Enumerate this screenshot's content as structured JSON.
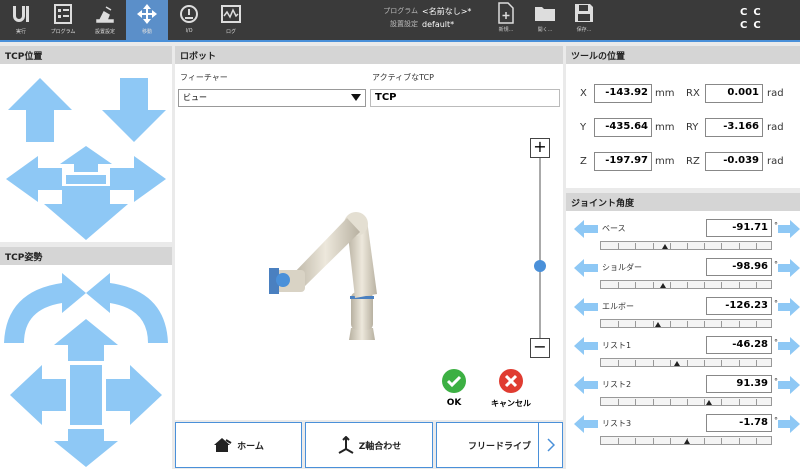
{
  "topbar": {
    "nav": [
      {
        "label": "実行",
        "icon": "ur-logo-icon"
      },
      {
        "label": "プログラム",
        "icon": "program-icon"
      },
      {
        "label": "設置設定",
        "icon": "installation-icon"
      },
      {
        "label": "移動",
        "icon": "move-icon"
      },
      {
        "label": "I/O",
        "icon": "io-icon"
      },
      {
        "label": "ログ",
        "icon": "log-icon"
      }
    ],
    "program_label": "プログラム",
    "program_value": "<名前なし>*",
    "install_label": "設置設定",
    "install_value": "default*",
    "new_label": "新規...",
    "open_label": "開く...",
    "save_label": "保存...",
    "cc_text": "CC CC"
  },
  "tcp_position": {
    "title": "TCP位置"
  },
  "tcp_orientation": {
    "title": "TCP姿勢"
  },
  "robot": {
    "title": "ロボット",
    "feature_label": "フィーチャー",
    "feature_value": "ビュー",
    "active_tcp_label": "アクティブなTCP",
    "active_tcp_value": "TCP",
    "zoom_in": "+",
    "zoom_out": "−",
    "zoom_level": 0.4,
    "ok_label": "OK",
    "cancel_label": "キャンセル"
  },
  "tool_position": {
    "title": "ツールの位置",
    "rows": [
      {
        "axis": "X",
        "value": "-143.92",
        "unit": "mm",
        "raxis": "RX",
        "rvalue": "0.001",
        "runit": "rad"
      },
      {
        "axis": "Y",
        "value": "-435.64",
        "unit": "mm",
        "raxis": "RY",
        "rvalue": "-3.166",
        "runit": "rad"
      },
      {
        "axis": "Z",
        "value": "-197.97",
        "unit": "mm",
        "raxis": "RZ",
        "rvalue": "-0.039",
        "runit": "rad"
      }
    ]
  },
  "joints": {
    "title": "ジョイント角度",
    "unit": "°",
    "items": [
      {
        "label": "ベース",
        "value": "-91.71",
        "pos": 0.37
      },
      {
        "label": "ショルダー",
        "value": "-98.96",
        "pos": 0.36
      },
      {
        "label": "エルボー",
        "value": "-126.23",
        "pos": 0.33
      },
      {
        "label": "リスト1",
        "value": "-46.28",
        "pos": 0.44
      },
      {
        "label": "リスト2",
        "value": "91.39",
        "pos": 0.63
      },
      {
        "label": "リスト3",
        "value": "-1.78",
        "pos": 0.5
      }
    ]
  },
  "bottom": {
    "home_label": "ホーム",
    "align_label": "Z軸合わせ",
    "freedrive_label": "フリードライブ"
  }
}
